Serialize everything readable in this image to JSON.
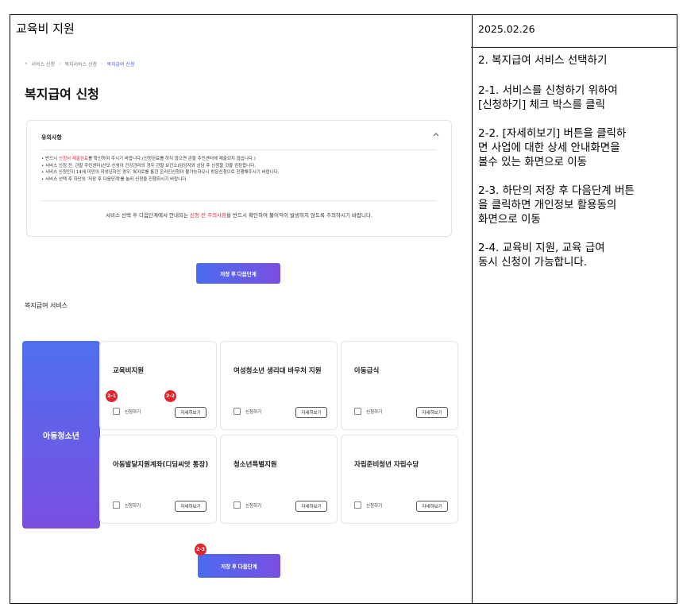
{
  "doc": {
    "title": "교육비 지원",
    "date": "2025.02.26"
  },
  "notes": [
    "2. 복지급여 서비스 선택하기",
    "2-1. 서비스를 신청하기 위하여\n[신청하기] 체크 박스를 클릭",
    "2-2. [자세히보기] 버튼을 클릭하\n면 사업에 대한 상세 안내화면을\n볼수 있는 화면으로 이동",
    "2-3. 하단의 저장 후 다음단계 버튼\n을 클릭하면 개인정보 활용동의\n화면으로 이동",
    "2-4. 교육비 지원, 교육 급여\n동시 신청이 가능합니다."
  ],
  "screen": {
    "breadcrumb": [
      "서비스 신청",
      "복지서비스 신청",
      "복지급여 신청"
    ],
    "page_title": "복지급여 신청",
    "notice": {
      "heading": "유의사항",
      "line1_pre": "• 반드시 ",
      "line1_red": "신청서 제출완료",
      "line1_post": "를 확인하여 주시기 바랍니다.(신청완료를 하지 않으면 관할 주민센터에 제출되지 않습니다.)",
      "line2": "• 서비스 신청 전, 관할 주민센터(산모·신생아 건강관리의 경우 관할 보건소)담당자와 상담 후 신청할 것을 권장합니다.",
      "line3": "• 서비스 신청인이 14세 미만의 미성년자인 경우, 복지로를 통한 온라인신청이 불가능하오니 방문신청으로 진행해주시기 바랍니다.",
      "line4": "• 서비스 선택 후 하단의 '저장 후 다음단계'를 눌러 신청을 진행하시기 바랍니다.",
      "foot_pre": "서비스 선택 후 다음단계에서 안내되는 ",
      "foot_red": "신청 전 주의사항",
      "foot_post": "을 반드시 확인하여 불이익이 발생하지 않도록 주의하시기 바랍니다."
    },
    "save_next_label": "저장 후 다음단계",
    "section_label": "복지급여 서비스",
    "category": "아동청소년",
    "apply_label": "신청하기",
    "detail_label": "자세히보기",
    "cards": [
      "교육비지원",
      "여성청소년 생리대 바우처 지원",
      "아동급식",
      "아동발달지원계좌(디딤씨앗 통장)",
      "청소년특별지원",
      "자립준비청년 자립수당"
    ],
    "badges": [
      "2-1",
      "2-2",
      "2-3"
    ],
    "accent_color": "#4a6cf0",
    "badge_color": "#e2232a"
  }
}
